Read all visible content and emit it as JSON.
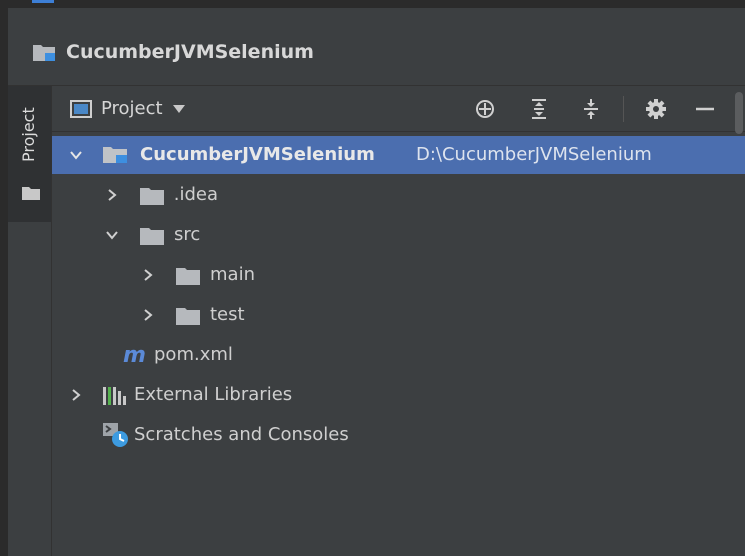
{
  "navbar": {
    "project_name": "CucumberJVMSelenium"
  },
  "side_tab": {
    "label": "Project"
  },
  "toolbar": {
    "view_label": "Project",
    "buttons": [
      "locate-icon",
      "expand-all-icon",
      "collapse-all-icon",
      "gear-icon",
      "minimize-icon"
    ]
  },
  "tree": {
    "root": {
      "name": "CucumberJVMSelenium",
      "path": "D:\\CucumberJVMSelenium"
    },
    "idea": " .idea",
    "src": "src",
    "main": "main",
    "test": "test",
    "pom": "pom.xml",
    "external_libraries": "External Libraries",
    "scratches": "Scratches and Consoles"
  },
  "colors": {
    "background": "#3c3f41",
    "selection": "#4b6eaf",
    "folder": "#b6b9bd",
    "module_accent": "#3d8fe0",
    "maven": "#5b8ad8"
  }
}
